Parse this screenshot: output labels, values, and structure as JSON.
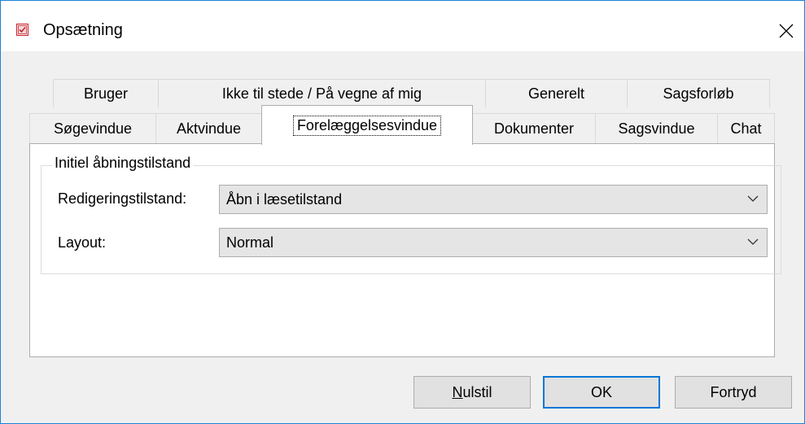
{
  "window": {
    "title": "Opsætning",
    "icons": {
      "app": "checklist-app-icon",
      "close": "close-icon"
    }
  },
  "tabs": {
    "row_back": [
      "Bruger",
      "Ikke til stede / På vegne af mig",
      "Generelt",
      "Sagsforløb"
    ],
    "row_front": [
      "Søgevindue",
      "Aktvindue",
      "Forelæggelsesvindue",
      "Dokumenter",
      "Sagsvindue",
      "Chat"
    ],
    "active": "Forelæggelsesvindue"
  },
  "group": {
    "legend": "Initiel åbningstilstand",
    "edit_mode_label": "Redigeringstilstand:",
    "edit_mode_value": "Åbn i læsetilstand",
    "layout_label": "Layout:",
    "layout_value": "Normal"
  },
  "buttons": {
    "reset_mnemonic": "N",
    "reset_rest": "ulstil",
    "ok": "OK",
    "cancel": "Fortryd"
  },
  "colors": {
    "accent": "#0078d7",
    "window_border": "#1883d7",
    "app_icon_red": "#c4262e"
  }
}
